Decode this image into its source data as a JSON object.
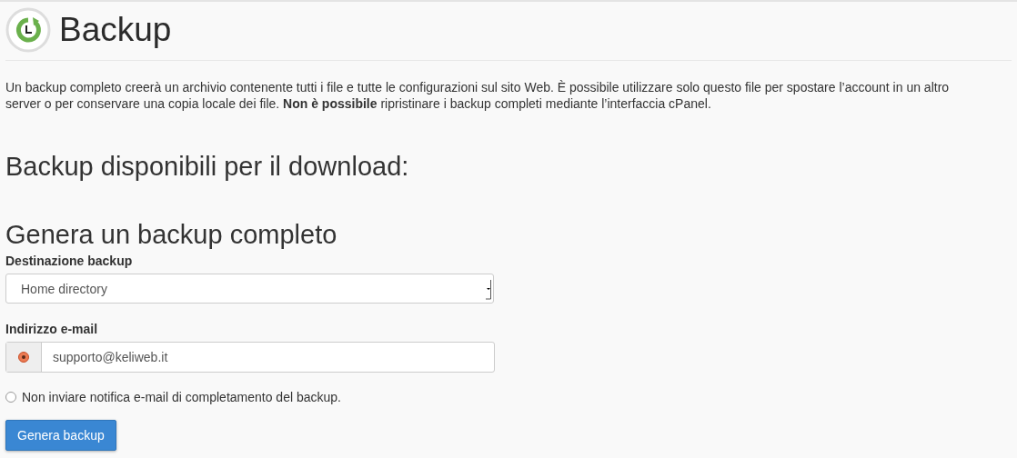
{
  "header": {
    "title": "Backup"
  },
  "intro": "Un backup completo creerà un archivio contenente tutti i file e tutte le configurazioni sul sito Web. È possibile utilizzare solo questo file per spostare l’account in un altro server o per conservare una copia locale dei file. **Non è possibile** ripristinare i backup completi mediante l’interfaccia cPanel.",
  "downloads_heading": "Backup disponibili per il download:",
  "generate_heading": "Genera un backup completo",
  "destination": {
    "label": "Destinazione backup",
    "value": "Home directory"
  },
  "email": {
    "label": "Indirizzo e-mail",
    "value": "supporto@keliweb.it",
    "selected": true
  },
  "no_email_option": {
    "label": "Non inviare notifica e-mail di completamento del backup.",
    "selected": false
  },
  "button": "Genera backup"
}
